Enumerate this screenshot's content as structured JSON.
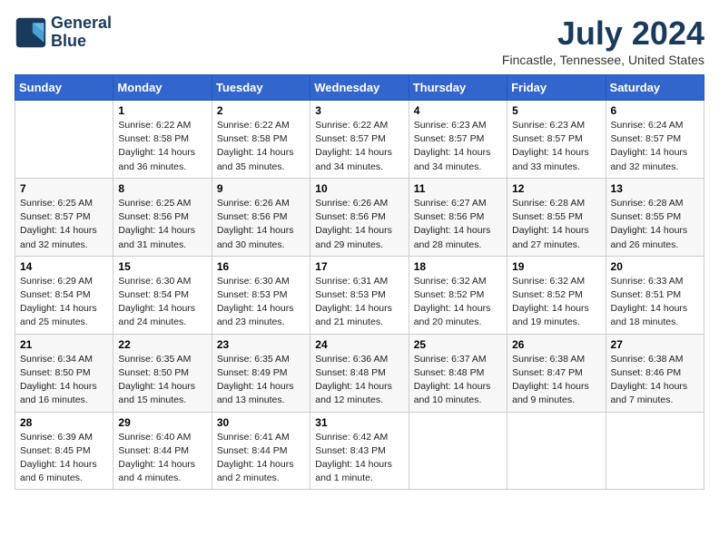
{
  "logo": {
    "line1": "General",
    "line2": "Blue"
  },
  "title": "July 2024",
  "subtitle": "Fincastle, Tennessee, United States",
  "days_of_week": [
    "Sunday",
    "Monday",
    "Tuesday",
    "Wednesday",
    "Thursday",
    "Friday",
    "Saturday"
  ],
  "weeks": [
    [
      {
        "day": "",
        "text": ""
      },
      {
        "day": "1",
        "text": "Sunrise: 6:22 AM\nSunset: 8:58 PM\nDaylight: 14 hours\nand 36 minutes."
      },
      {
        "day": "2",
        "text": "Sunrise: 6:22 AM\nSunset: 8:58 PM\nDaylight: 14 hours\nand 35 minutes."
      },
      {
        "day": "3",
        "text": "Sunrise: 6:22 AM\nSunset: 8:57 PM\nDaylight: 14 hours\nand 34 minutes."
      },
      {
        "day": "4",
        "text": "Sunrise: 6:23 AM\nSunset: 8:57 PM\nDaylight: 14 hours\nand 34 minutes."
      },
      {
        "day": "5",
        "text": "Sunrise: 6:23 AM\nSunset: 8:57 PM\nDaylight: 14 hours\nand 33 minutes."
      },
      {
        "day": "6",
        "text": "Sunrise: 6:24 AM\nSunset: 8:57 PM\nDaylight: 14 hours\nand 32 minutes."
      }
    ],
    [
      {
        "day": "7",
        "text": "Sunrise: 6:25 AM\nSunset: 8:57 PM\nDaylight: 14 hours\nand 32 minutes."
      },
      {
        "day": "8",
        "text": "Sunrise: 6:25 AM\nSunset: 8:56 PM\nDaylight: 14 hours\nand 31 minutes."
      },
      {
        "day": "9",
        "text": "Sunrise: 6:26 AM\nSunset: 8:56 PM\nDaylight: 14 hours\nand 30 minutes."
      },
      {
        "day": "10",
        "text": "Sunrise: 6:26 AM\nSunset: 8:56 PM\nDaylight: 14 hours\nand 29 minutes."
      },
      {
        "day": "11",
        "text": "Sunrise: 6:27 AM\nSunset: 8:56 PM\nDaylight: 14 hours\nand 28 minutes."
      },
      {
        "day": "12",
        "text": "Sunrise: 6:28 AM\nSunset: 8:55 PM\nDaylight: 14 hours\nand 27 minutes."
      },
      {
        "day": "13",
        "text": "Sunrise: 6:28 AM\nSunset: 8:55 PM\nDaylight: 14 hours\nand 26 minutes."
      }
    ],
    [
      {
        "day": "14",
        "text": "Sunrise: 6:29 AM\nSunset: 8:54 PM\nDaylight: 14 hours\nand 25 minutes."
      },
      {
        "day": "15",
        "text": "Sunrise: 6:30 AM\nSunset: 8:54 PM\nDaylight: 14 hours\nand 24 minutes."
      },
      {
        "day": "16",
        "text": "Sunrise: 6:30 AM\nSunset: 8:53 PM\nDaylight: 14 hours\nand 23 minutes."
      },
      {
        "day": "17",
        "text": "Sunrise: 6:31 AM\nSunset: 8:53 PM\nDaylight: 14 hours\nand 21 minutes."
      },
      {
        "day": "18",
        "text": "Sunrise: 6:32 AM\nSunset: 8:52 PM\nDaylight: 14 hours\nand 20 minutes."
      },
      {
        "day": "19",
        "text": "Sunrise: 6:32 AM\nSunset: 8:52 PM\nDaylight: 14 hours\nand 19 minutes."
      },
      {
        "day": "20",
        "text": "Sunrise: 6:33 AM\nSunset: 8:51 PM\nDaylight: 14 hours\nand 18 minutes."
      }
    ],
    [
      {
        "day": "21",
        "text": "Sunrise: 6:34 AM\nSunset: 8:50 PM\nDaylight: 14 hours\nand 16 minutes."
      },
      {
        "day": "22",
        "text": "Sunrise: 6:35 AM\nSunset: 8:50 PM\nDaylight: 14 hours\nand 15 minutes."
      },
      {
        "day": "23",
        "text": "Sunrise: 6:35 AM\nSunset: 8:49 PM\nDaylight: 14 hours\nand 13 minutes."
      },
      {
        "day": "24",
        "text": "Sunrise: 6:36 AM\nSunset: 8:48 PM\nDaylight: 14 hours\nand 12 minutes."
      },
      {
        "day": "25",
        "text": "Sunrise: 6:37 AM\nSunset: 8:48 PM\nDaylight: 14 hours\nand 10 minutes."
      },
      {
        "day": "26",
        "text": "Sunrise: 6:38 AM\nSunset: 8:47 PM\nDaylight: 14 hours\nand 9 minutes."
      },
      {
        "day": "27",
        "text": "Sunrise: 6:38 AM\nSunset: 8:46 PM\nDaylight: 14 hours\nand 7 minutes."
      }
    ],
    [
      {
        "day": "28",
        "text": "Sunrise: 6:39 AM\nSunset: 8:45 PM\nDaylight: 14 hours\nand 6 minutes."
      },
      {
        "day": "29",
        "text": "Sunrise: 6:40 AM\nSunset: 8:44 PM\nDaylight: 14 hours\nand 4 minutes."
      },
      {
        "day": "30",
        "text": "Sunrise: 6:41 AM\nSunset: 8:44 PM\nDaylight: 14 hours\nand 2 minutes."
      },
      {
        "day": "31",
        "text": "Sunrise: 6:42 AM\nSunset: 8:43 PM\nDaylight: 14 hours\nand 1 minute."
      },
      {
        "day": "",
        "text": ""
      },
      {
        "day": "",
        "text": ""
      },
      {
        "day": "",
        "text": ""
      }
    ]
  ]
}
